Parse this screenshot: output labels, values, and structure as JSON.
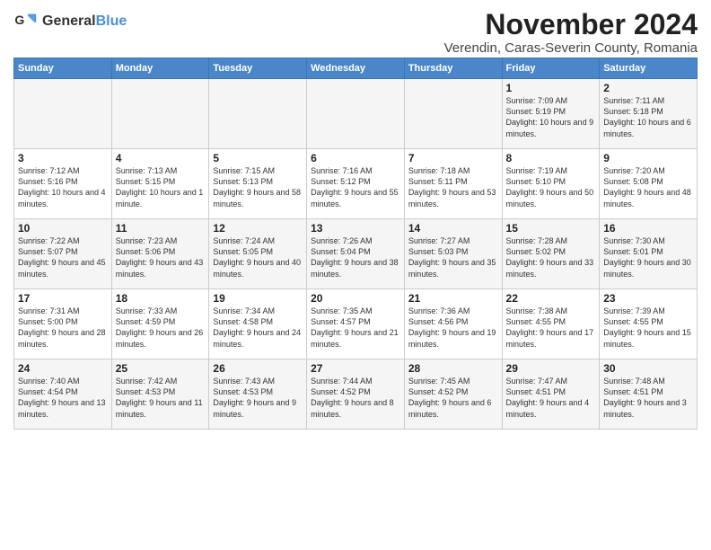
{
  "logo": {
    "general": "General",
    "blue": "Blue"
  },
  "title": "November 2024",
  "location": "Verendin, Caras-Severin County, Romania",
  "headers": [
    "Sunday",
    "Monday",
    "Tuesday",
    "Wednesday",
    "Thursday",
    "Friday",
    "Saturday"
  ],
  "weeks": [
    [
      {
        "day": "",
        "info": ""
      },
      {
        "day": "",
        "info": ""
      },
      {
        "day": "",
        "info": ""
      },
      {
        "day": "",
        "info": ""
      },
      {
        "day": "",
        "info": ""
      },
      {
        "day": "1",
        "info": "Sunrise: 7:09 AM\nSunset: 5:19 PM\nDaylight: 10 hours and 9 minutes."
      },
      {
        "day": "2",
        "info": "Sunrise: 7:11 AM\nSunset: 5:18 PM\nDaylight: 10 hours and 6 minutes."
      }
    ],
    [
      {
        "day": "3",
        "info": "Sunrise: 7:12 AM\nSunset: 5:16 PM\nDaylight: 10 hours and 4 minutes."
      },
      {
        "day": "4",
        "info": "Sunrise: 7:13 AM\nSunset: 5:15 PM\nDaylight: 10 hours and 1 minute."
      },
      {
        "day": "5",
        "info": "Sunrise: 7:15 AM\nSunset: 5:13 PM\nDaylight: 9 hours and 58 minutes."
      },
      {
        "day": "6",
        "info": "Sunrise: 7:16 AM\nSunset: 5:12 PM\nDaylight: 9 hours and 55 minutes."
      },
      {
        "day": "7",
        "info": "Sunrise: 7:18 AM\nSunset: 5:11 PM\nDaylight: 9 hours and 53 minutes."
      },
      {
        "day": "8",
        "info": "Sunrise: 7:19 AM\nSunset: 5:10 PM\nDaylight: 9 hours and 50 minutes."
      },
      {
        "day": "9",
        "info": "Sunrise: 7:20 AM\nSunset: 5:08 PM\nDaylight: 9 hours and 48 minutes."
      }
    ],
    [
      {
        "day": "10",
        "info": "Sunrise: 7:22 AM\nSunset: 5:07 PM\nDaylight: 9 hours and 45 minutes."
      },
      {
        "day": "11",
        "info": "Sunrise: 7:23 AM\nSunset: 5:06 PM\nDaylight: 9 hours and 43 minutes."
      },
      {
        "day": "12",
        "info": "Sunrise: 7:24 AM\nSunset: 5:05 PM\nDaylight: 9 hours and 40 minutes."
      },
      {
        "day": "13",
        "info": "Sunrise: 7:26 AM\nSunset: 5:04 PM\nDaylight: 9 hours and 38 minutes."
      },
      {
        "day": "14",
        "info": "Sunrise: 7:27 AM\nSunset: 5:03 PM\nDaylight: 9 hours and 35 minutes."
      },
      {
        "day": "15",
        "info": "Sunrise: 7:28 AM\nSunset: 5:02 PM\nDaylight: 9 hours and 33 minutes."
      },
      {
        "day": "16",
        "info": "Sunrise: 7:30 AM\nSunset: 5:01 PM\nDaylight: 9 hours and 30 minutes."
      }
    ],
    [
      {
        "day": "17",
        "info": "Sunrise: 7:31 AM\nSunset: 5:00 PM\nDaylight: 9 hours and 28 minutes."
      },
      {
        "day": "18",
        "info": "Sunrise: 7:33 AM\nSunset: 4:59 PM\nDaylight: 9 hours and 26 minutes."
      },
      {
        "day": "19",
        "info": "Sunrise: 7:34 AM\nSunset: 4:58 PM\nDaylight: 9 hours and 24 minutes."
      },
      {
        "day": "20",
        "info": "Sunrise: 7:35 AM\nSunset: 4:57 PM\nDaylight: 9 hours and 21 minutes."
      },
      {
        "day": "21",
        "info": "Sunrise: 7:36 AM\nSunset: 4:56 PM\nDaylight: 9 hours and 19 minutes."
      },
      {
        "day": "22",
        "info": "Sunrise: 7:38 AM\nSunset: 4:55 PM\nDaylight: 9 hours and 17 minutes."
      },
      {
        "day": "23",
        "info": "Sunrise: 7:39 AM\nSunset: 4:55 PM\nDaylight: 9 hours and 15 minutes."
      }
    ],
    [
      {
        "day": "24",
        "info": "Sunrise: 7:40 AM\nSunset: 4:54 PM\nDaylight: 9 hours and 13 minutes."
      },
      {
        "day": "25",
        "info": "Sunrise: 7:42 AM\nSunset: 4:53 PM\nDaylight: 9 hours and 11 minutes."
      },
      {
        "day": "26",
        "info": "Sunrise: 7:43 AM\nSunset: 4:53 PM\nDaylight: 9 hours and 9 minutes."
      },
      {
        "day": "27",
        "info": "Sunrise: 7:44 AM\nSunset: 4:52 PM\nDaylight: 9 hours and 8 minutes."
      },
      {
        "day": "28",
        "info": "Sunrise: 7:45 AM\nSunset: 4:52 PM\nDaylight: 9 hours and 6 minutes."
      },
      {
        "day": "29",
        "info": "Sunrise: 7:47 AM\nSunset: 4:51 PM\nDaylight: 9 hours and 4 minutes."
      },
      {
        "day": "30",
        "info": "Sunrise: 7:48 AM\nSunset: 4:51 PM\nDaylight: 9 hours and 3 minutes."
      }
    ]
  ]
}
